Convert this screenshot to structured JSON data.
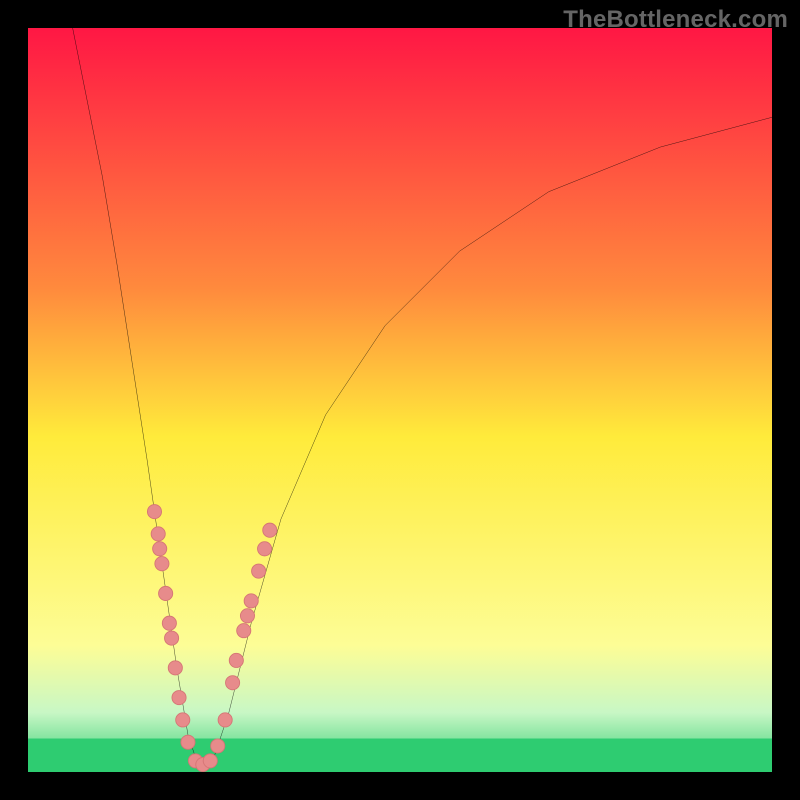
{
  "watermark": "TheBottleneck.com",
  "colors": {
    "outer_border": "#000000",
    "curve": "#000000",
    "marker_fill": "#E78B8B",
    "marker_stroke": "#D57575",
    "green_band": "#2ECC71",
    "gradient_top": "#FF1744",
    "gradient_mid": "#FFEB3B",
    "gradient_lower": "#FDFD96",
    "gradient_bottom": "#2ECC71"
  },
  "chart_data": {
    "type": "line",
    "title": "",
    "xlabel": "",
    "ylabel": "",
    "xlim": [
      0,
      100
    ],
    "ylim": [
      0,
      100
    ],
    "grid": false,
    "legend": false,
    "note": "V-shaped bottleneck curve on red→yellow→green vertical gradient. Curve descends from top-left to a minimum near x≈23 at y≈0, then rises toward upper-right. Scattered pink markers cluster along the lower branches of the V (roughly y 0–35). No axis ticks or numeric labels are visible.",
    "series": [
      {
        "name": "bottleneck-curve",
        "points": [
          {
            "x": 6.0,
            "y": 100.0
          },
          {
            "x": 8.0,
            "y": 90.0
          },
          {
            "x": 10.0,
            "y": 80.0
          },
          {
            "x": 12.0,
            "y": 68.0
          },
          {
            "x": 14.0,
            "y": 55.0
          },
          {
            "x": 16.0,
            "y": 42.0
          },
          {
            "x": 18.0,
            "y": 28.0
          },
          {
            "x": 20.0,
            "y": 14.0
          },
          {
            "x": 21.5,
            "y": 5.0
          },
          {
            "x": 23.0,
            "y": 0.5
          },
          {
            "x": 25.0,
            "y": 2.0
          },
          {
            "x": 27.0,
            "y": 8.0
          },
          {
            "x": 30.0,
            "y": 20.0
          },
          {
            "x": 34.0,
            "y": 34.0
          },
          {
            "x": 40.0,
            "y": 48.0
          },
          {
            "x": 48.0,
            "y": 60.0
          },
          {
            "x": 58.0,
            "y": 70.0
          },
          {
            "x": 70.0,
            "y": 78.0
          },
          {
            "x": 85.0,
            "y": 84.0
          },
          {
            "x": 100.0,
            "y": 88.0
          }
        ]
      }
    ],
    "markers": [
      {
        "x": 17.0,
        "y": 35.0
      },
      {
        "x": 17.5,
        "y": 32.0
      },
      {
        "x": 17.7,
        "y": 30.0
      },
      {
        "x": 18.0,
        "y": 28.0
      },
      {
        "x": 18.5,
        "y": 24.0
      },
      {
        "x": 19.0,
        "y": 20.0
      },
      {
        "x": 19.3,
        "y": 18.0
      },
      {
        "x": 19.8,
        "y": 14.0
      },
      {
        "x": 20.3,
        "y": 10.0
      },
      {
        "x": 20.8,
        "y": 7.0
      },
      {
        "x": 21.5,
        "y": 4.0
      },
      {
        "x": 22.5,
        "y": 1.5
      },
      {
        "x": 23.5,
        "y": 1.0
      },
      {
        "x": 24.5,
        "y": 1.5
      },
      {
        "x": 25.5,
        "y": 3.5
      },
      {
        "x": 26.5,
        "y": 7.0
      },
      {
        "x": 27.5,
        "y": 12.0
      },
      {
        "x": 28.0,
        "y": 15.0
      },
      {
        "x": 29.0,
        "y": 19.0
      },
      {
        "x": 29.5,
        "y": 21.0
      },
      {
        "x": 30.0,
        "y": 23.0
      },
      {
        "x": 31.0,
        "y": 27.0
      },
      {
        "x": 31.8,
        "y": 30.0
      },
      {
        "x": 32.5,
        "y": 32.5
      }
    ]
  }
}
